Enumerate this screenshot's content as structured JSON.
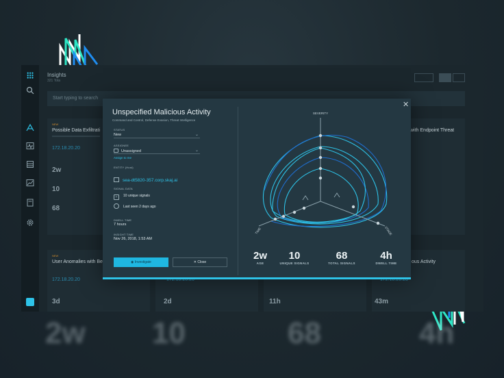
{
  "background": {
    "big_numbers": [
      "2w",
      "10",
      "68",
      "4h"
    ]
  },
  "app": {
    "title": "Insights",
    "subtitle": "321 Tota",
    "search_placeholder": "Start typing to search",
    "sidebar_icons": [
      "grid-icon",
      "search-icon",
      "insights-icon",
      "pulse-icon",
      "database-icon",
      "chart-icon",
      "reports-icon",
      "gear-icon",
      "avatar"
    ],
    "cards": [
      {
        "tag": "NEW",
        "title": "Possible Data Exfiltrati",
        "ip": "172.18.20.20",
        "stats": [
          "2w",
          "10",
          "68"
        ]
      },
      {
        "tag": "",
        "title": "with Endpoint Threat",
        "ip": "",
        "stats": []
      },
      {
        "tag": "NEW",
        "title": "User Anomalies with Be",
        "ip": "172.18.20.20",
        "stats": [
          "3d"
        ]
      },
      {
        "tag": "",
        "title": "",
        "ip": "172.18.20.20",
        "stats": [
          "2d"
        ]
      },
      {
        "tag": "",
        "title": "",
        "ip": "",
        "stats": [
          "11h"
        ]
      },
      {
        "tag": "",
        "title": "ous Activity",
        "ip": "172.18.20.20",
        "stats": [
          "43m"
        ]
      }
    ]
  },
  "modal": {
    "title": "Unspecified Malicious Activity",
    "subtitle": "Command and Control, Defense Evasion, Threat Intelligence",
    "status_label": "STATUS",
    "status_value": "New",
    "assignee_label": "ASSIGNEE",
    "assignee_value": "Unassigned",
    "assign_link": "Assign to me",
    "entity_label": "ENTITY (Host)",
    "entity_value": "sea-dt5820-357.corp.skaj.ai",
    "signal_label": "SIGNAL DATA",
    "signal_count": "10 unique signals",
    "last_seen": "Last seen 2 days ago",
    "dwell_label": "DWELL TIME",
    "dwell_value": "7 hours",
    "insight_label": "INSIGHT TIME",
    "insight_value": "Nov 26, 2018, 1:53 AM",
    "investigate_label": "Investigate",
    "close_label": "Close",
    "radar_axes": [
      "SEVERITY",
      "TIME",
      "STAGE"
    ],
    "kpis": [
      {
        "value": "2w",
        "label": "AGE"
      },
      {
        "value": "10",
        "label": "UNIQUE SIGNALS"
      },
      {
        "value": "68",
        "label": "TOTAL SIGNALS"
      },
      {
        "value": "4h",
        "label": "DWELL TIME"
      }
    ]
  },
  "colors": {
    "accent": "#2ec3e8",
    "accent_dark": "#1f6fd1",
    "warning": "#d08b2e",
    "modal_bg": "#243842"
  }
}
